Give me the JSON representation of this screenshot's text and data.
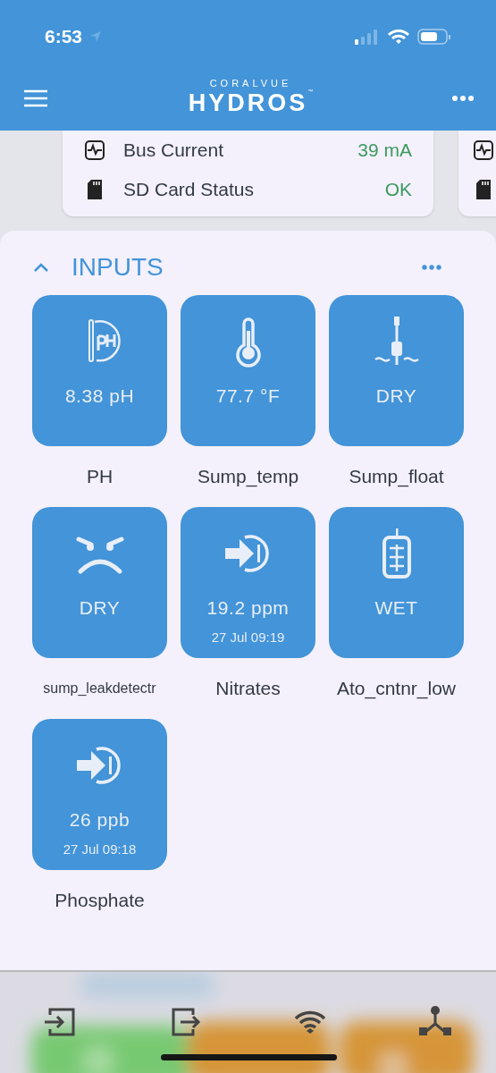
{
  "status_bar": {
    "time": "6:53"
  },
  "header": {
    "brand_top": "CORALVUE",
    "brand": "HYDROS",
    "trademark": "™"
  },
  "status_card": {
    "rows": [
      {
        "kind": "current",
        "label": "Bus Current",
        "value": "39 mA"
      },
      {
        "kind": "sdcard",
        "label": "SD Card Status",
        "value": "OK"
      }
    ]
  },
  "inputs_section": {
    "title": "INPUTS",
    "expanded": true,
    "inputs": [
      {
        "kind": "ph",
        "name": "PH",
        "value": "8.38 pH"
      },
      {
        "kind": "temp",
        "name": "Sump_temp",
        "value": "77.7 °F"
      },
      {
        "kind": "float",
        "name": "Sump_float",
        "value": "DRY"
      },
      {
        "kind": "leak",
        "name": "sump_leakdetectr",
        "value": "DRY"
      },
      {
        "kind": "manual",
        "name": "Nitrates",
        "value": "19.2 ppm",
        "time": "27 Jul 09:19"
      },
      {
        "kind": "optical",
        "name": "Ato_cntnr_low",
        "value": "WET"
      },
      {
        "kind": "manual",
        "name": "Phosphate",
        "value": "26 ppb",
        "time": "27 Jul 09:18"
      }
    ]
  },
  "tab_bar": {
    "items": [
      {
        "kind": "inputs"
      },
      {
        "kind": "outputs"
      },
      {
        "kind": "wifi"
      },
      {
        "kind": "network"
      }
    ]
  }
}
